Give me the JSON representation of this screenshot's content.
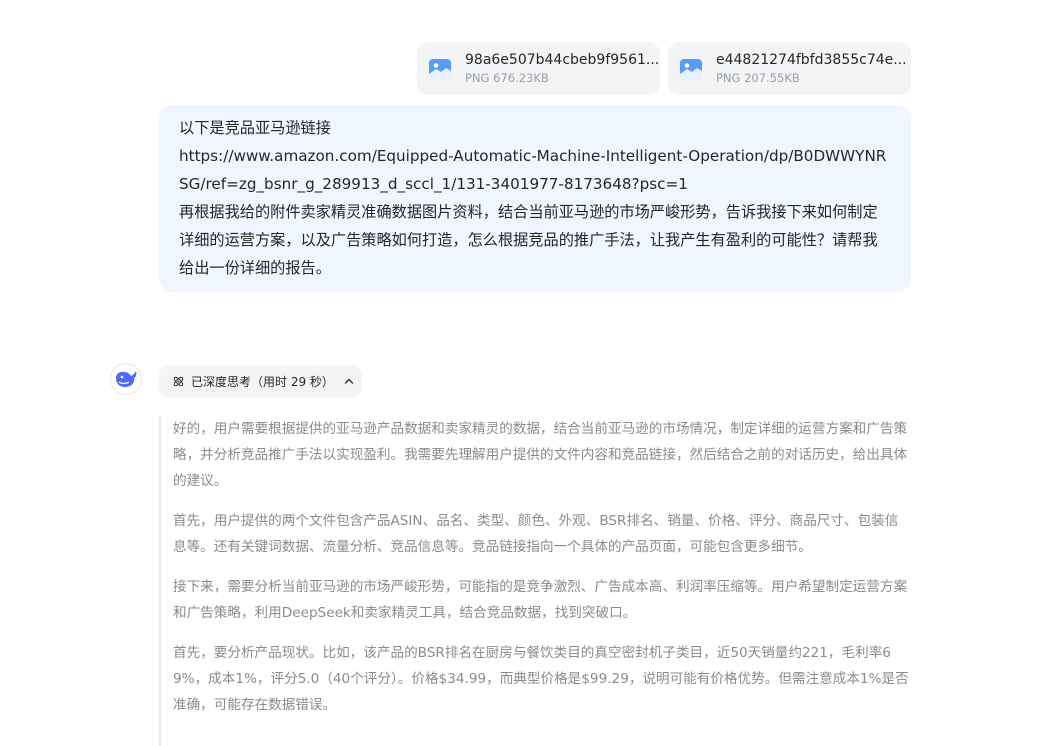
{
  "attachments": [
    {
      "name": "98a6e507b44cbeb9f9561...",
      "meta": "PNG 676.23KB",
      "icon": "image-file-icon"
    },
    {
      "name": "e44821274fbfd3855c74e...",
      "meta": "PNG 207.55KB",
      "icon": "image-file-icon"
    }
  ],
  "user_message": {
    "lines": [
      "以下是竞品亚马逊链接",
      "https://www.amazon.com/Equipped-Automatic-Machine-Intelligent-Operation/dp/B0DWWYNRSG/ref=zg_bsnr_g_289913_d_sccl_1/131-3401977-8173648?psc=1",
      "再根据我给的附件卖家精灵准确数据图片资料，结合当前亚马逊的市场严峻形势，告诉我接下来如何制定详细的运营方案，以及广告策略如何打造，怎么根据竞品的推广手法，让我产生有盈利的可能性？请帮我给出一份详细的报告。"
    ]
  },
  "assistant": {
    "avatar_icon": "whale-logo-icon",
    "think_label": "已深度思考（用时 29 秒）",
    "think_icon": "atom-icon",
    "collapse_icon": "chevron-up-icon",
    "thinking_paragraphs": [
      "好的，用户需要根据提供的亚马逊产品数据和卖家精灵的数据，结合当前亚马逊的市场情况，制定详细的运营方案和广告策略，并分析竞品推广手法以实现盈利。我需要先理解用户提供的文件内容和竞品链接，然后结合之前的对话历史，给出具体的建议。",
      "首先，用户提供的两个文件包含产品ASIN、品名、类型、颜色、外观、BSR排名、销量、价格、评分、商品尺寸、包装信息等。还有关键词数据、流量分析、竞品信息等。竞品链接指向一个具体的产品页面，可能包含更多细节。",
      "接下来，需要分析当前亚马逊的市场严峻形势，可能指的是竞争激烈、广告成本高、利润率压缩等。用户希望制定运营方案和广告策略，利用DeepSeek和卖家精灵工具，结合竞品数据，找到突破口。",
      "首先，要分析产品现状。比如，该产品的BSR排名在厨房与餐饮类目的真空密封机子类目，近50天销量约221，毛利率69%，成本1%，评分5.0（40个评分）。价格$34.99，而典型价格是$99.29，说明可能有价格优势。但需注意成本1%是否准确，可能存在数据错误。"
    ]
  },
  "colors": {
    "user_bubble": "#eff6ff",
    "file_card": "#f3f4f6",
    "thinking_text": "#8b8b8b",
    "brand_blue": "#4d6bfe"
  }
}
